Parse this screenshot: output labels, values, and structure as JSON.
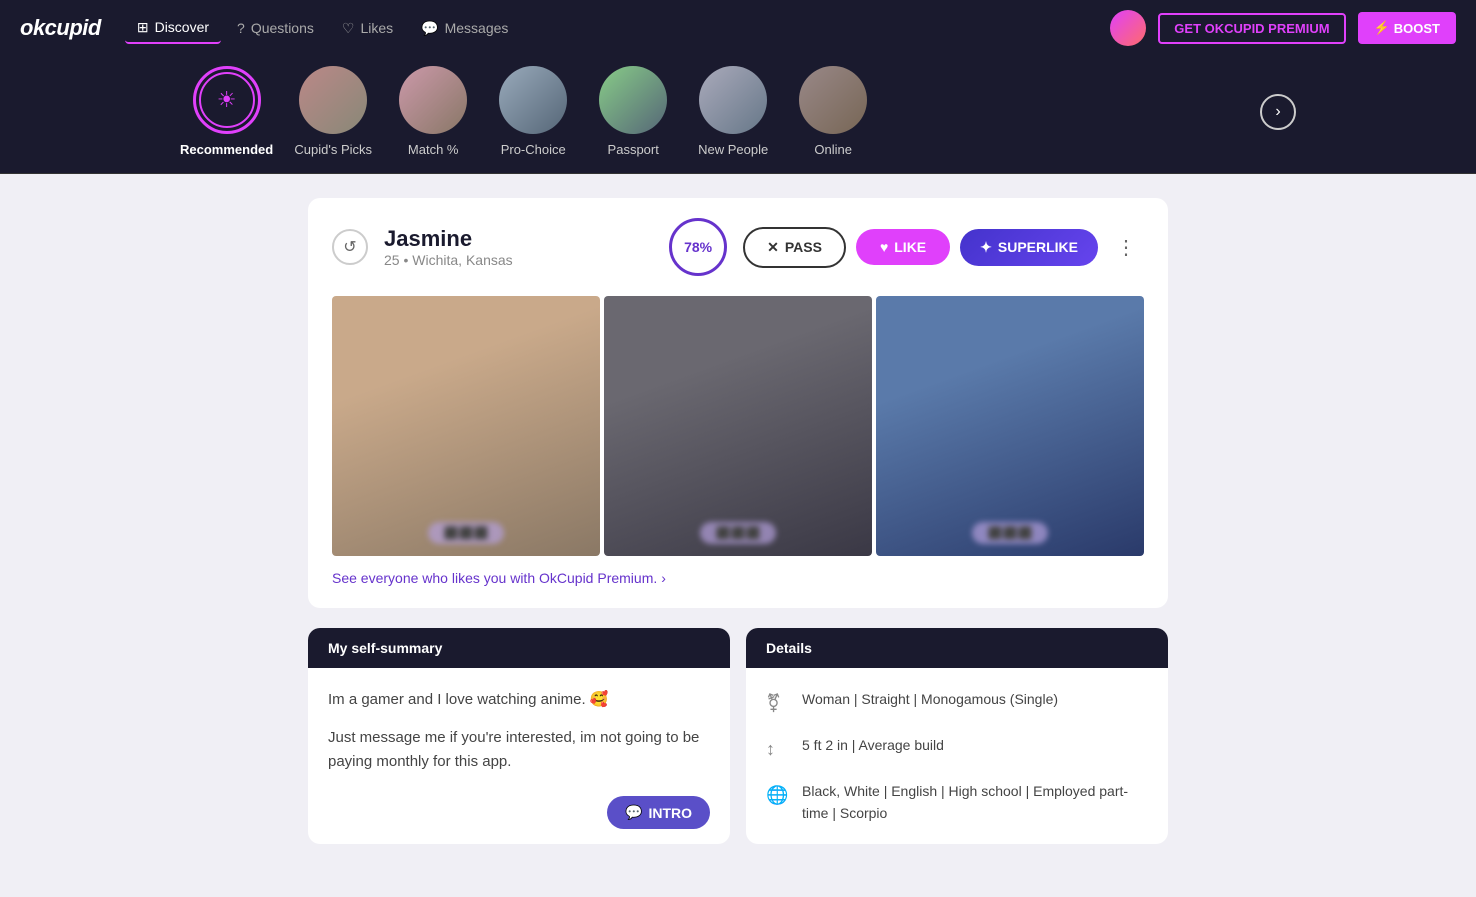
{
  "brand": {
    "name": "okcupid"
  },
  "nav": {
    "items": [
      {
        "id": "discover",
        "label": "Discover",
        "active": true
      },
      {
        "id": "questions",
        "label": "Questions",
        "active": false
      },
      {
        "id": "likes",
        "label": "Likes",
        "active": false
      },
      {
        "id": "messages",
        "label": "Messages",
        "active": false
      }
    ],
    "premium_btn": "GET OKCUPID PREMIUM",
    "boost_btn": "BOOST"
  },
  "categories": [
    {
      "id": "recommended",
      "label": "Recommended",
      "active": true,
      "type": "icon"
    },
    {
      "id": "cupids_picks",
      "label": "Cupid's Picks",
      "active": false,
      "type": "photo",
      "bg": "cat-photo-1"
    },
    {
      "id": "match",
      "label": "Match %",
      "active": false,
      "type": "photo",
      "bg": "cat-photo-2"
    },
    {
      "id": "pro_choice",
      "label": "Pro-Choice",
      "active": false,
      "type": "photo",
      "bg": "cat-photo-3"
    },
    {
      "id": "passport",
      "label": "Passport",
      "active": false,
      "type": "photo",
      "bg": "cat-photo-4"
    },
    {
      "id": "new_people",
      "label": "New People",
      "active": false,
      "type": "photo",
      "bg": "cat-photo-5"
    },
    {
      "id": "online",
      "label": "Online",
      "active": false,
      "type": "photo",
      "bg": "cat-photo-6"
    }
  ],
  "profile": {
    "name": "Jasmine",
    "age": "25",
    "location": "Wichita, Kansas",
    "match_percent": "78%",
    "pass_label": "PASS",
    "like_label": "LIKE",
    "superlike_label": "SUPERLIKE",
    "premium_link": "See everyone who likes you with OkCupid Premium.",
    "self_summary_header": "My self-summary",
    "self_summary_p1": "Im a gamer and I love watching anime. 🥰",
    "self_summary_p2": "Just message me if you're interested, im not going to be paying monthly for this app.",
    "intro_label": "INTRO",
    "details_header": "Details",
    "details": [
      {
        "icon": "gender",
        "text": "Woman | Straight | Monogamous (Single)"
      },
      {
        "icon": "height",
        "text": "5 ft 2 in | Average build"
      },
      {
        "icon": "globe",
        "text": "Black, White | English | High school | Employed part-time | Scorpio"
      }
    ]
  }
}
